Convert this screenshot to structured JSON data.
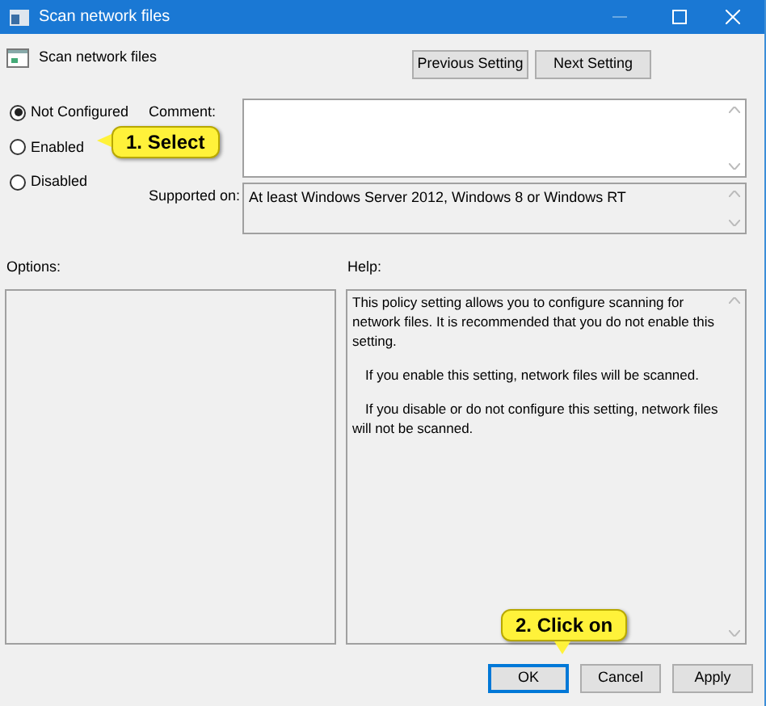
{
  "window": {
    "title": "Scan network files"
  },
  "policy": {
    "name": "Scan network files"
  },
  "nav_buttons": [
    "Previous Setting",
    "Next Setting"
  ],
  "options": [
    {
      "label": "Not Configured",
      "selected": true
    },
    {
      "label": "Enabled",
      "selected": false
    },
    {
      "label": "Disabled",
      "selected": false
    }
  ],
  "comment": {
    "label": "Comment:"
  },
  "supported_on": {
    "label": "Supported on:",
    "value": "At least Windows Server 2012, Windows 8 or Windows RT"
  },
  "options_panel": {
    "label": "Options:"
  },
  "help": {
    "label": "Help:",
    "paragraphs": [
      {
        "text": "This policy setting allows you to configure scanning for network files. It is recommended that you do not enable this setting.",
        "indent": false
      },
      {
        "text": "If you enable this setting, network files will be scanned.",
        "indent": true
      },
      {
        "text": "If you disable or do not configure this setting, network files will not be scanned.",
        "indent": true
      }
    ]
  },
  "buttons": [
    {
      "label": "OK",
      "focused": true
    },
    {
      "label": "Cancel",
      "focused": false
    },
    {
      "label": "Apply",
      "focused": false
    }
  ],
  "callouts": [
    {
      "text": "1. Select",
      "kind": "left"
    },
    {
      "text": "2. Click on",
      "kind": "down"
    }
  ]
}
